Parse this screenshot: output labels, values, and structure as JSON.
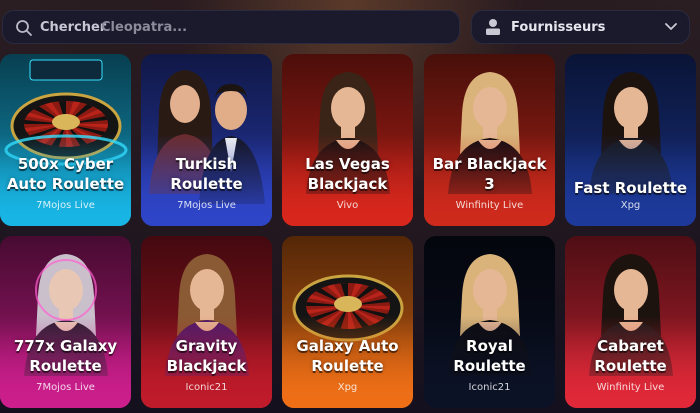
{
  "search": {
    "placeholder_main": "Chercher",
    "placeholder_sub": "Cleopatra..."
  },
  "providers_filter": {
    "label": "Fournisseurs"
  },
  "games": [
    {
      "title_lines": [
        "500x Cyber",
        "Auto Roulette"
      ],
      "provider": "7Mojos Live",
      "color": "#18b5e4",
      "scene": "cyber-roulette-wheel"
    },
    {
      "title_lines": [
        "Turkish",
        "Roulette"
      ],
      "provider": "7Mojos Live",
      "color": "#2f45c8",
      "scene": "dealers-portrait"
    },
    {
      "title_lines": [
        "Las Vegas",
        "Blackjack"
      ],
      "provider": "Vivo",
      "color": "#d8271c",
      "scene": "dealer-portrait"
    },
    {
      "title_lines": [
        "Bar Blackjack",
        "3"
      ],
      "provider": "Winfinity Live",
      "color": "#cf2a1c",
      "scene": "dealer-portrait"
    },
    {
      "title_lines": [
        "Fast Roulette"
      ],
      "provider": "Xpg",
      "color": "#1d3a9b",
      "scene": "dealer-portrait"
    },
    {
      "title_lines": [
        "777x Galaxy",
        "Roulette"
      ],
      "provider": "7Mojos Live",
      "color": "#cc1e8c",
      "scene": "cyber-dealer"
    },
    {
      "title_lines": [
        "Gravity",
        "Blackjack"
      ],
      "provider": "Iconic21",
      "color": "#c01b2a",
      "scene": "dealer-portrait"
    },
    {
      "title_lines": [
        "Galaxy Auto",
        "Roulette"
      ],
      "provider": "Xpg",
      "color": "#ef6f16",
      "scene": "roulette-wheel"
    },
    {
      "title_lines": [
        "Royal",
        "Roulette"
      ],
      "provider": "Iconic21",
      "color": "#0c1226",
      "scene": "dealer-portrait"
    },
    {
      "title_lines": [
        "Cabaret",
        "Roulette"
      ],
      "provider": "Winfinity Live",
      "color": "#e02838",
      "scene": "dealer-portrait"
    }
  ]
}
